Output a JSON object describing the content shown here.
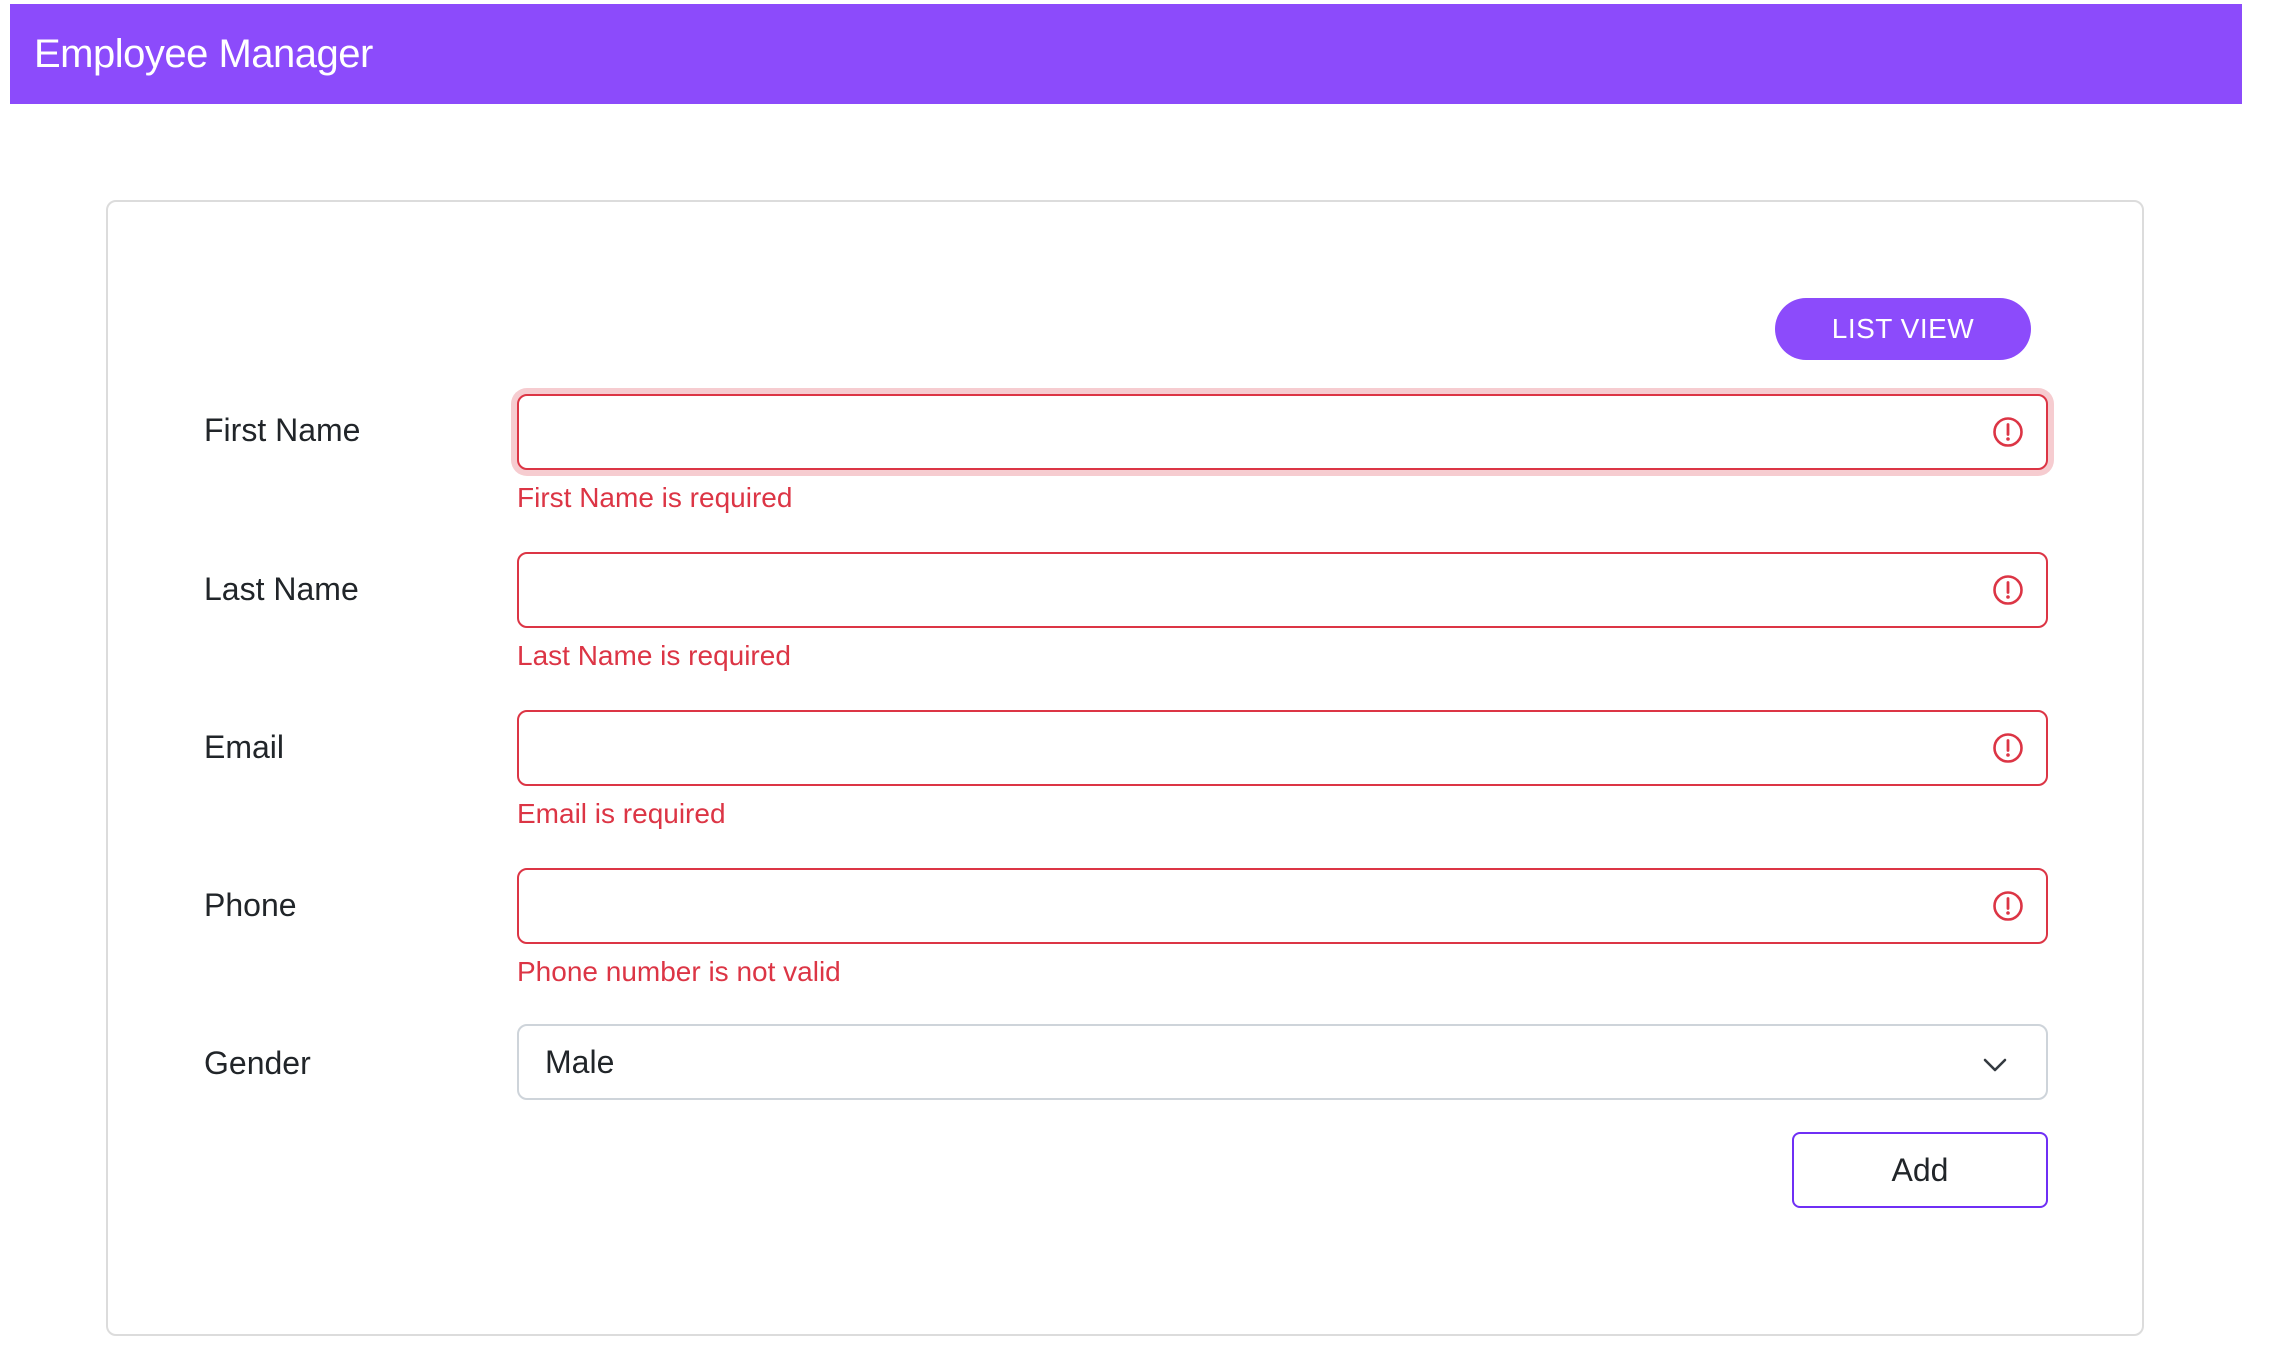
{
  "app": {
    "title": "Employee Manager",
    "brand_color": "#8c4bfb",
    "error_color": "#dc3545"
  },
  "toolbar": {
    "list_view_label": "LIST VIEW"
  },
  "form": {
    "first_name": {
      "label": "First Name",
      "value": "",
      "error": "First Name is required",
      "icon": "exclamation-circle-icon"
    },
    "last_name": {
      "label": "Last Name",
      "value": "",
      "error": "Last Name is required",
      "icon": "exclamation-circle-icon"
    },
    "email": {
      "label": "Email",
      "value": "",
      "error": "Email is required",
      "icon": "exclamation-circle-icon"
    },
    "phone": {
      "label": "Phone",
      "value": "",
      "error": "Phone number is not valid",
      "icon": "exclamation-circle-icon"
    },
    "gender": {
      "label": "Gender",
      "selected": "Male",
      "icon": "chevron-down-icon"
    },
    "add_label": "Add"
  }
}
